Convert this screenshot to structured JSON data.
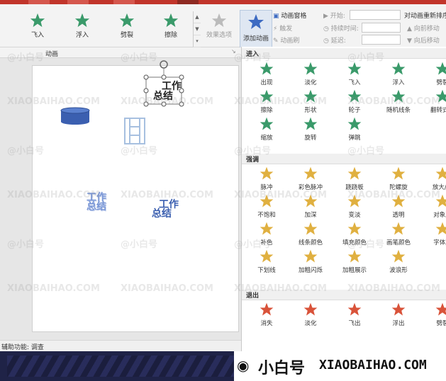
{
  "ribbon": {
    "gallery": [
      "飞入",
      "浮入",
      "劈裂",
      "擦除"
    ],
    "effect_options": "效果选项",
    "add_animation": "添加动画",
    "animation_pane": "动画窗格",
    "trigger": "触发",
    "animation_painter": "动画刷",
    "start_label": "开始:",
    "duration_label": "持续时间:",
    "delay_label": "延迟:",
    "reorder_title": "对动画重新排序",
    "move_earlier": "向前移动",
    "move_later": "向后移动",
    "group_label": "动画"
  },
  "panel": {
    "entrance": {
      "title": "进入",
      "items": [
        "出现",
        "淡化",
        "飞入",
        "浮入",
        "劈裂",
        "擦除",
        "形状",
        "轮子",
        "随机线条",
        "翻转式由",
        "缩放",
        "旋转",
        "弹跳"
      ]
    },
    "emphasis": {
      "title": "强调",
      "items": [
        "脉冲",
        "彩色脉冲",
        "跷跷板",
        "陀螺旋",
        "放大/缩",
        "不饱和",
        "加深",
        "变淡",
        "透明",
        "对象颜",
        "补色",
        "线条颜色",
        "填充颜色",
        "画笔颜色",
        "字体颜",
        "下划线",
        "加粗闪烁",
        "加粗展示",
        "波浪形"
      ]
    },
    "exit": {
      "title": "退出",
      "items": [
        "消失",
        "淡化",
        "飞出",
        "浮出",
        "劈裂"
      ]
    }
  },
  "slide": {
    "text1": "工作",
    "text2": "总结",
    "text3": "工作",
    "text4": "总结",
    "text5": "工作",
    "text6": "总结"
  },
  "status": {
    "accessibility": "辅助功能: 调查"
  },
  "brand": {
    "name": "小白号",
    "url": "XIAOBAIHAO.COM"
  },
  "watermark": {
    "cn": "@小白号",
    "en": "XIAOBAIHAO.COM"
  },
  "colors": {
    "entrance": "#3a9a6a",
    "emphasis": "#e0b040",
    "exit": "#d9533a",
    "topbar": "#c1352b"
  }
}
